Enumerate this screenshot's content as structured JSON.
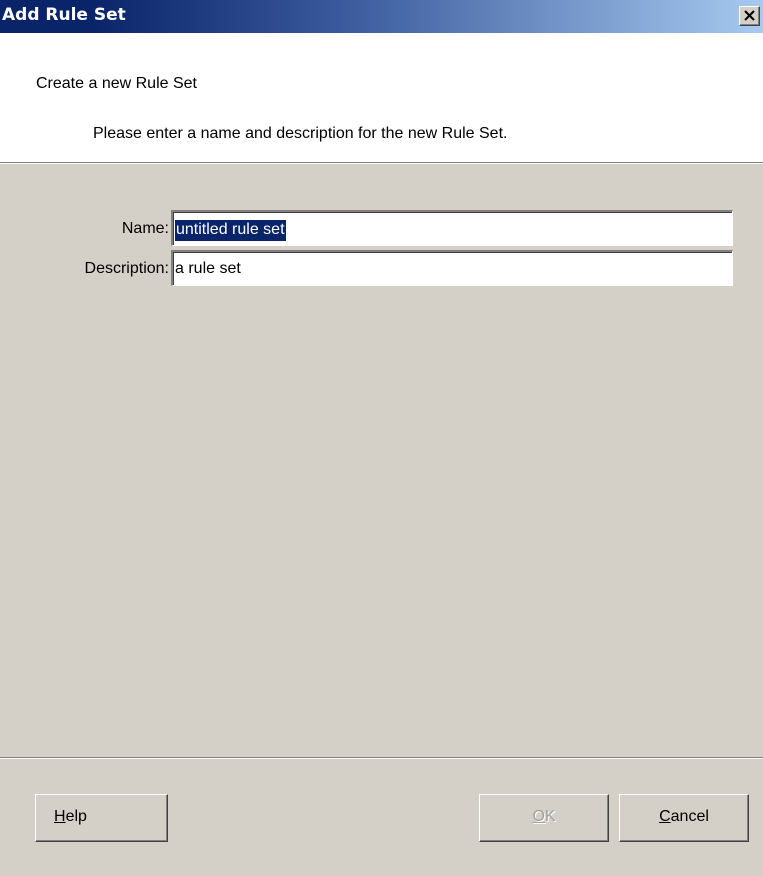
{
  "window": {
    "title": "Add Rule Set"
  },
  "header": {
    "title": "Create a new Rule Set",
    "description": "Please enter a name and description for the new Rule Set."
  },
  "form": {
    "name_label": "Name:",
    "name_value": "untitled rule set",
    "description_label": "Description:",
    "description_value": "a rule set"
  },
  "buttons": {
    "help_label": "Help",
    "ok_label": "OK",
    "cancel_label": "Cancel",
    "ok_enabled": false
  },
  "colors": {
    "titlebar_start": "#0a246a",
    "titlebar_end": "#a6caf0",
    "dialog_bg": "#d4d0c8",
    "selection_bg": "#0a246a"
  }
}
